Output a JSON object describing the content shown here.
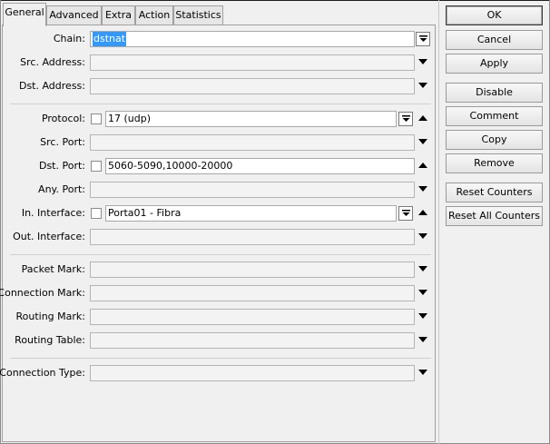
{
  "tabs": [
    "General",
    "Advanced",
    "Extra",
    "Action",
    "Statistics"
  ],
  "fields": {
    "chain": {
      "label": "Chain:",
      "value": "dstnat"
    },
    "src_address": {
      "label": "Src. Address:",
      "value": ""
    },
    "dst_address": {
      "label": "Dst. Address:",
      "value": ""
    },
    "protocol": {
      "label": "Protocol:",
      "value": "17 (udp)"
    },
    "src_port": {
      "label": "Src. Port:",
      "value": ""
    },
    "dst_port": {
      "label": "Dst. Port:",
      "value": "5060-5090,10000-20000"
    },
    "any_port": {
      "label": "Any. Port:",
      "value": ""
    },
    "in_interface": {
      "label": "In. Interface:",
      "value": "Porta01 - Fibra"
    },
    "out_interface": {
      "label": "Out. Interface:",
      "value": ""
    },
    "packet_mark": {
      "label": "Packet Mark:",
      "value": ""
    },
    "connection_mark": {
      "label": "Connection Mark:",
      "value": ""
    },
    "routing_mark": {
      "label": "Routing Mark:",
      "value": ""
    },
    "routing_table": {
      "label": "Routing Table:",
      "value": ""
    },
    "connection_type": {
      "label": "Connection Type:",
      "value": ""
    }
  },
  "buttons": {
    "ok": "OK",
    "cancel": "Cancel",
    "apply": "Apply",
    "disable": "Disable",
    "comment": "Comment",
    "copy": "Copy",
    "remove": "Remove",
    "reset_counters": "Reset Counters",
    "reset_all_counters": "Reset All Counters"
  },
  "icons": {
    "dropdown": "triangle-down-icon",
    "dropdown_button": "double-arrow-down-icon",
    "collapse": "triangle-up-icon"
  }
}
